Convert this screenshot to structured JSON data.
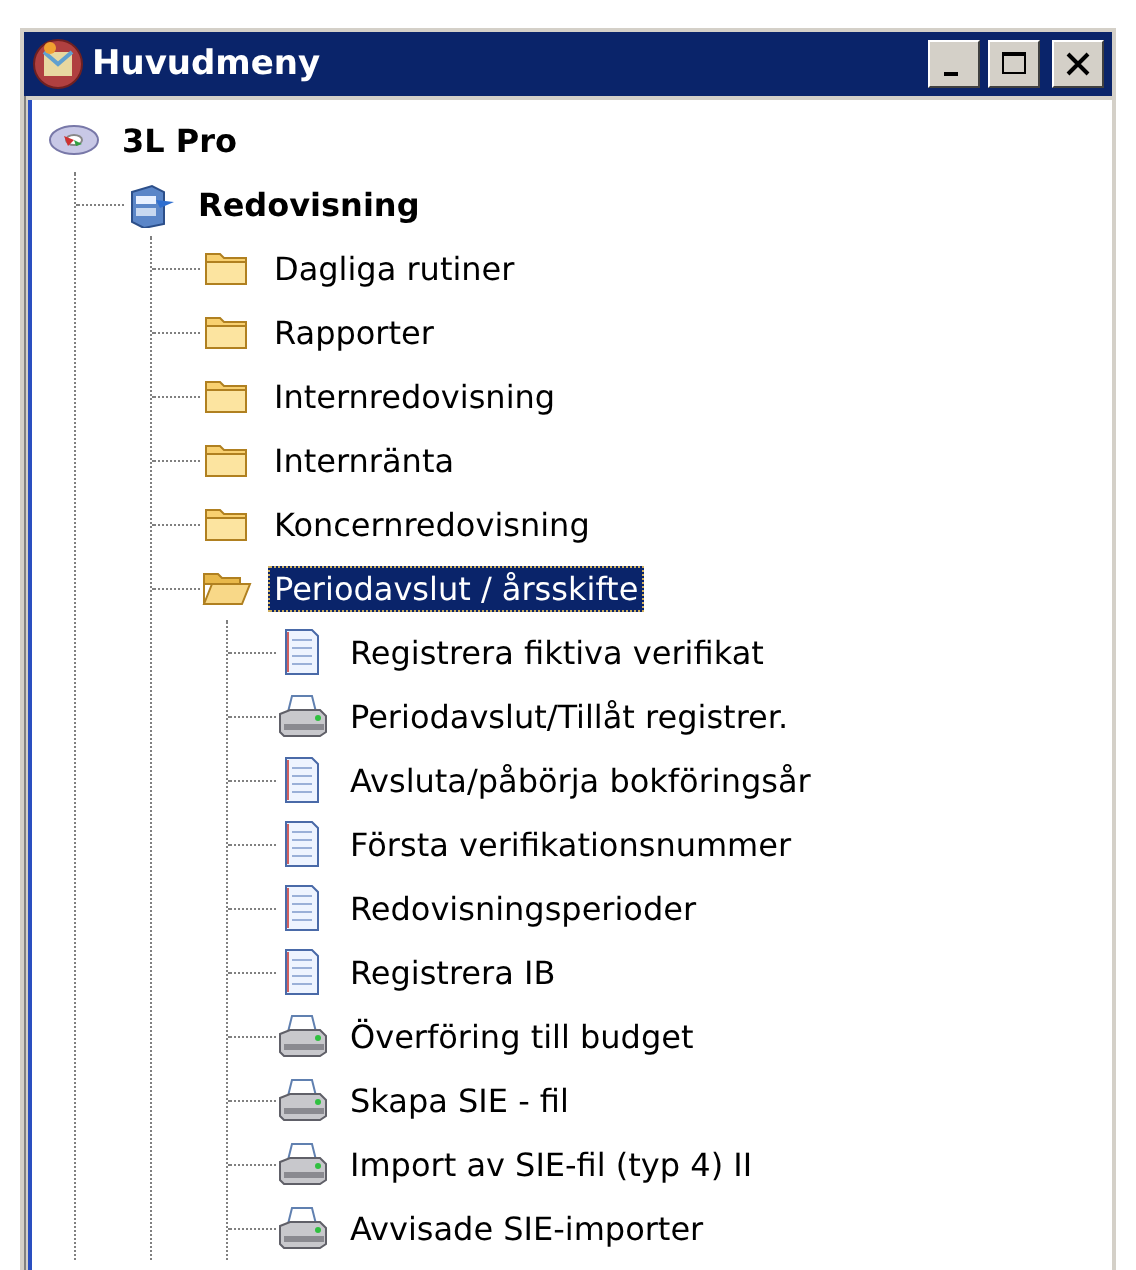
{
  "window": {
    "title": "Huvudmeny"
  },
  "tree": [
    {
      "label": "3L Pro",
      "kind": "application",
      "selected": false,
      "children": [
        {
          "label": "Redovisning",
          "kind": "module",
          "selected": false,
          "children": [
            {
              "label": "Dagliga rutiner",
              "kind": "folder",
              "expanded": false,
              "selected": false
            },
            {
              "label": "Rapporter",
              "kind": "folder",
              "expanded": false,
              "selected": false
            },
            {
              "label": "Internredovisning",
              "kind": "folder",
              "expanded": false,
              "selected": false
            },
            {
              "label": "Internränta",
              "kind": "folder",
              "expanded": false,
              "selected": false
            },
            {
              "label": "Koncernredovisning",
              "kind": "folder",
              "expanded": false,
              "selected": false
            },
            {
              "label": "Periodavslut / årsskifte",
              "kind": "folder",
              "expanded": true,
              "selected": true,
              "children": [
                {
                  "label": "Registrera fiktiva verifikat",
                  "kind": "document",
                  "selected": false
                },
                {
                  "label": "Periodavslut/Tillåt registrer.",
                  "kind": "printer",
                  "selected": false
                },
                {
                  "label": "Avsluta/påbörja bokföringsår",
                  "kind": "document",
                  "selected": false
                },
                {
                  "label": "Första verifikationsnummer",
                  "kind": "document",
                  "selected": false
                },
                {
                  "label": "Redovisningsperioder",
                  "kind": "document",
                  "selected": false
                },
                {
                  "label": "Registrera IB",
                  "kind": "document",
                  "selected": false
                },
                {
                  "label": "Överföring till budget",
                  "kind": "printer",
                  "selected": false
                },
                {
                  "label": "Skapa SIE - fil",
                  "kind": "printer",
                  "selected": false
                },
                {
                  "label": "Import av SIE-fil (typ 4) II",
                  "kind": "printer",
                  "selected": false
                },
                {
                  "label": "Avvisade SIE-importer",
                  "kind": "printer",
                  "selected": false
                }
              ]
            }
          ]
        }
      ]
    }
  ]
}
